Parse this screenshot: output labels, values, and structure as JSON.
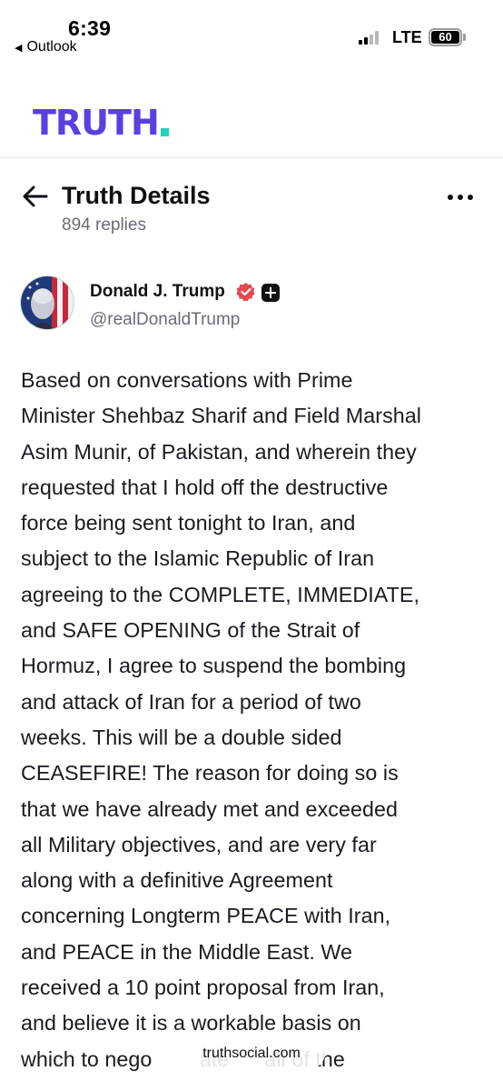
{
  "status_bar": {
    "time": "6:39",
    "back_app": "Outlook",
    "network": "LTE",
    "battery": "60"
  },
  "brand": {
    "logo": "TRUTH",
    "logo_color": "#5b3fe0",
    "dot_color": "#22d3b6"
  },
  "header": {
    "title": "Truth Details",
    "reply_count": "894 replies",
    "back_icon": "arrow-left-icon",
    "more_icon": "more-horizontal-icon"
  },
  "author": {
    "name": "Donald J. Trump",
    "handle": "@realDonaldTrump",
    "verified_color": "#e5484d"
  },
  "post": {
    "lines": [
      "Based on conversations with Prime",
      "Minister Shehbaz Sharif and Field Marshal",
      "Asim Munir, of Pakistan, and wherein they",
      "requested that I hold off the destructive",
      "force being sent tonight to Iran, and",
      "subject to the Islamic Republic of Iran",
      "agreeing to the COMPLETE, IMMEDIATE,",
      "and SAFE OPENING of the Strait of",
      "Hormuz, I agree to suspend the bombing",
      "and attack of Iran for a period of two",
      "weeks. This will be a double sided",
      "CEASEFIRE! The reason for doing so is",
      "that we have already met and exceeded",
      "all Military objectives, and are very far",
      "along with a definitive Agreement",
      "concerning Longterm PEACE with Iran,",
      "and PEACE in the Middle East. We",
      "received a 10 point proposal from Iran,",
      "and believe it is a workable basis on",
      "which to nego        ate      all of the"
    ]
  },
  "browser": {
    "url": "truthsocial.com"
  }
}
